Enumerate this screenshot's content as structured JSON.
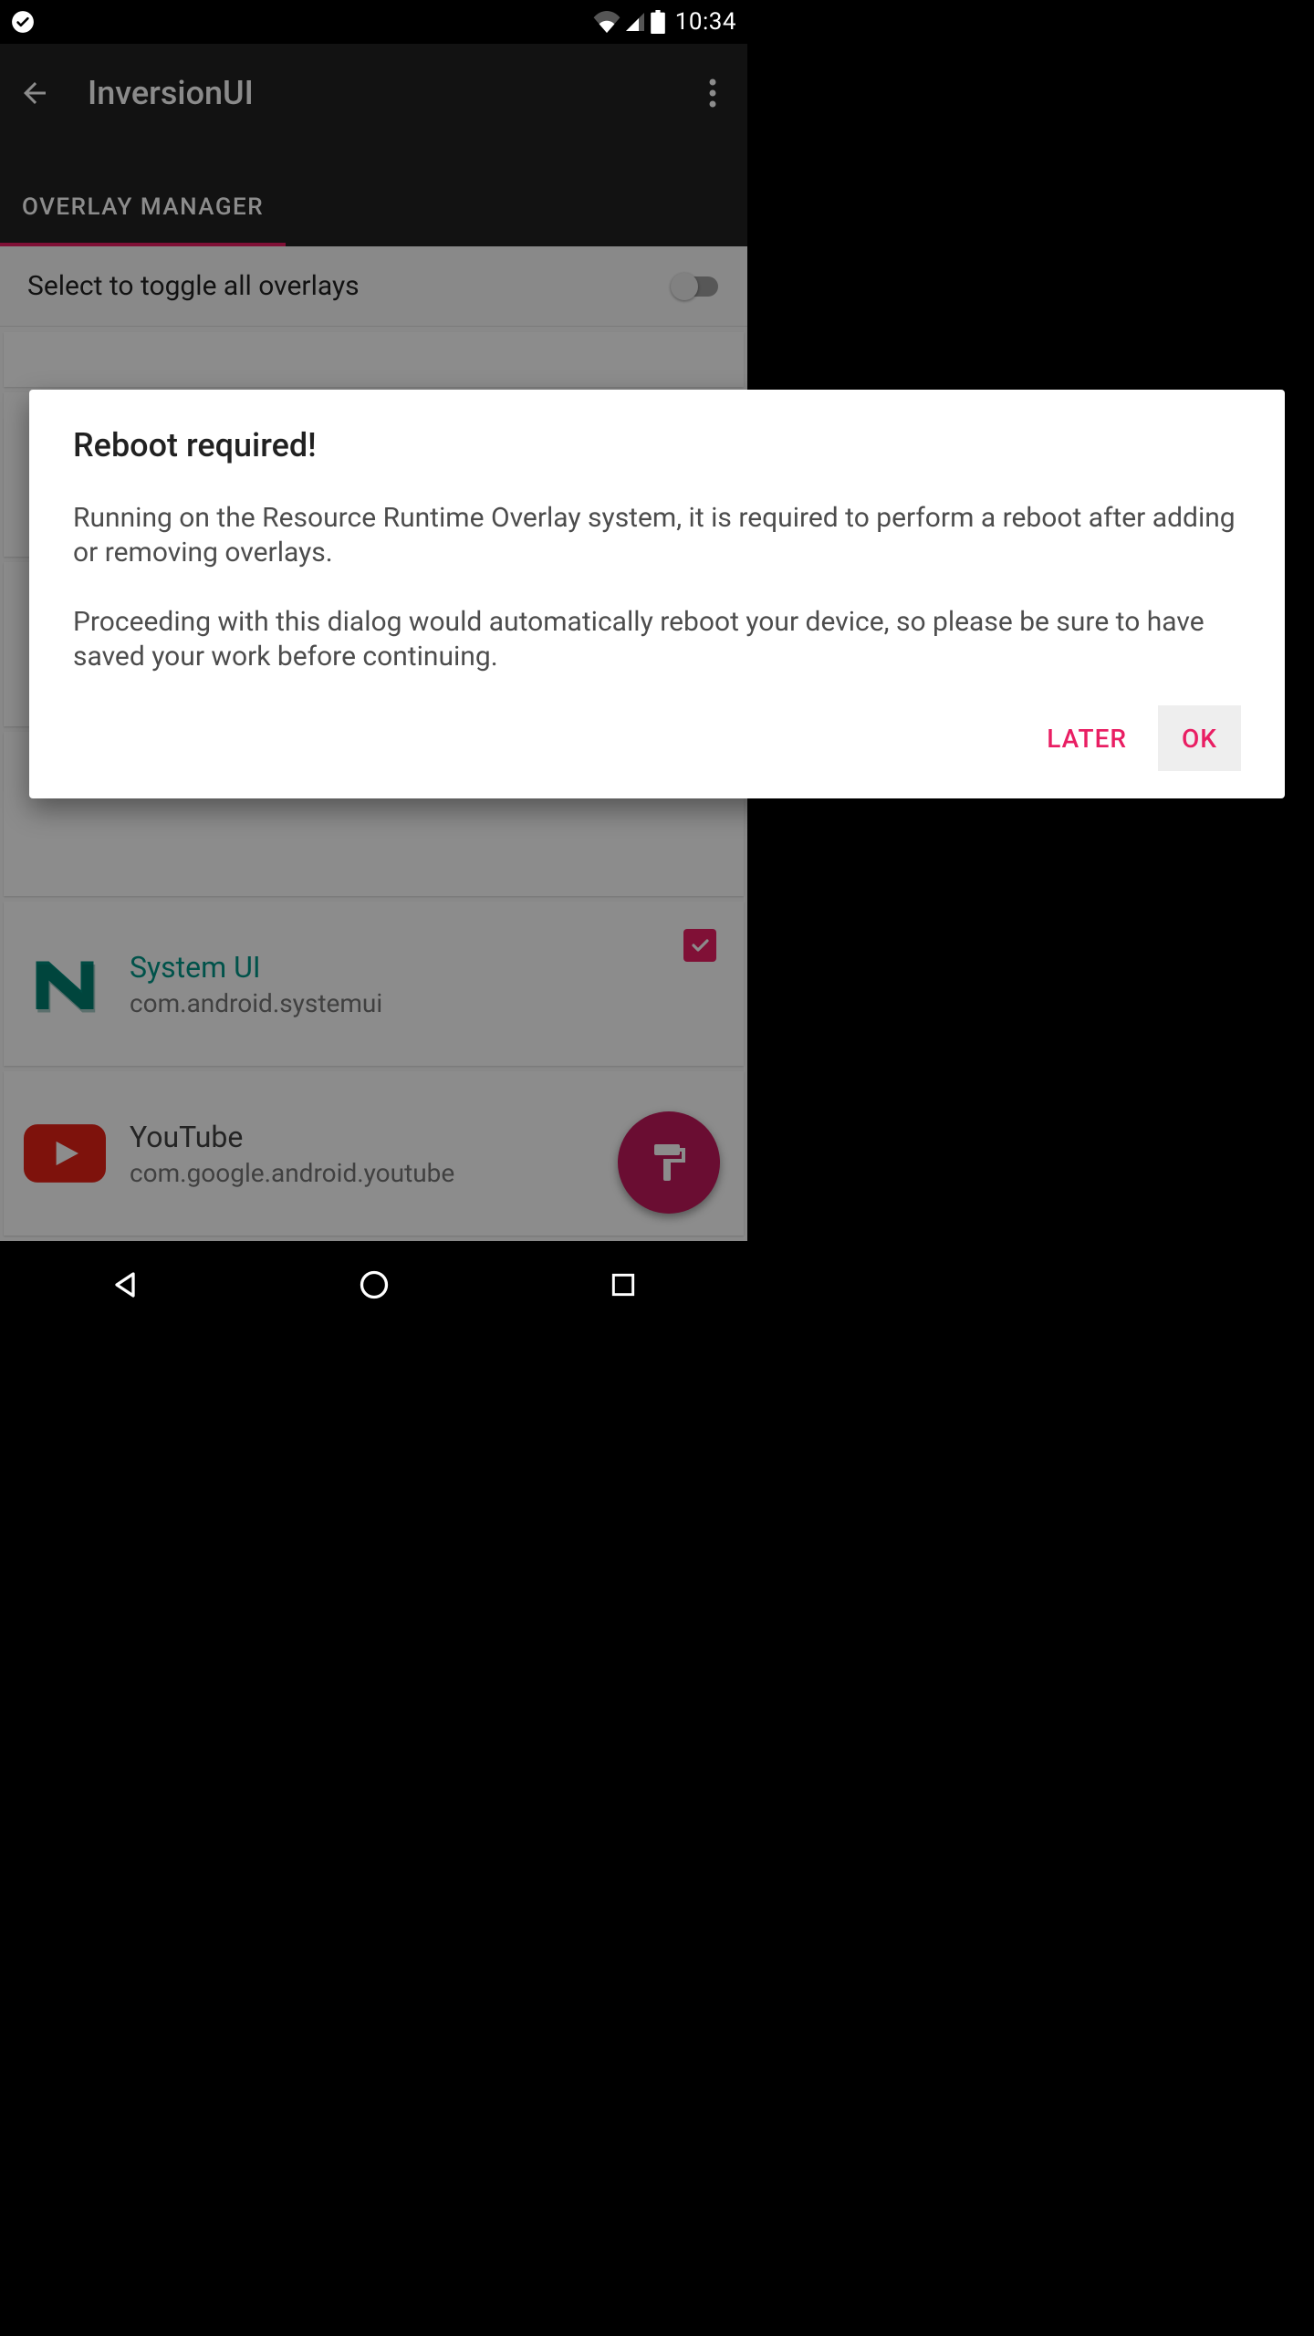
{
  "status": {
    "time": "10:34"
  },
  "appbar": {
    "title": "InversionUI"
  },
  "tab": {
    "label": "OVERLAY MANAGER"
  },
  "toggle": {
    "label": "Select to toggle all overlays"
  },
  "apps": {
    "systemui": {
      "name": "System UI",
      "pkg": "com.android.systemui"
    },
    "youtube": {
      "name": "YouTube",
      "pkg": "com.google.android.youtube"
    }
  },
  "dialog": {
    "title": "Reboot required!",
    "body": "Running on the Resource Runtime Overlay system, it is required to perform a reboot after adding or removing overlays.\n\nProceeding with this dialog would automatically reboot your device, so please be sure to have saved your work before continuing.",
    "later": "LATER",
    "ok": "OK"
  },
  "colors": {
    "accent": "#e91e63",
    "fab": "#c2185b",
    "teal": "#009688"
  }
}
